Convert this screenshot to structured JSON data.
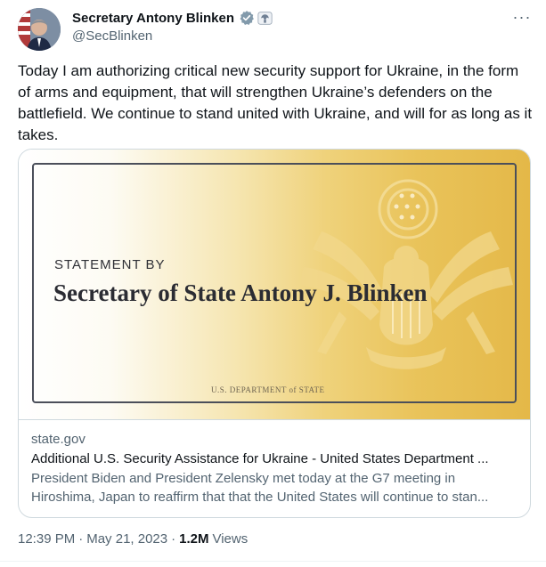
{
  "author": {
    "display_name": "Secretary Antony Blinken",
    "handle": "@SecBlinken",
    "verified_badge": "gray-verified-check-icon",
    "affiliation_badge": "us-government-seal-icon"
  },
  "more_menu": {
    "icon": "more-horizontal-icon",
    "glyph": "···"
  },
  "tweet": {
    "text": "Today I am authorizing critical new security support for Ukraine, in the form of arms and equipment, that will strengthen Ukraine’s defenders on the battlefield. We continue to stand united with Ukraine, and will for as long as it takes."
  },
  "card": {
    "image": {
      "heading_small": "STATEMENT BY",
      "heading_large": "Secretary of State Antony J. Blinken",
      "department": "U.S. DEPARTMENT of STATE"
    },
    "domain": "state.gov",
    "title": "Additional U.S. Security Assistance for Ukraine - United States Department ...",
    "description": "President Biden and President Zelensky met today at the G7 meeting in Hiroshima, Japan to reaffirm that that the United States will continue to stan..."
  },
  "meta": {
    "time": "12:39 PM",
    "separator": "·",
    "date": "May 21, 2023",
    "views_count": "1.2M",
    "views_label": "Views"
  },
  "colors": {
    "text_primary": "#0f1419",
    "text_secondary": "#536471",
    "border": "#cfd9de",
    "gold": "#e4b848"
  }
}
